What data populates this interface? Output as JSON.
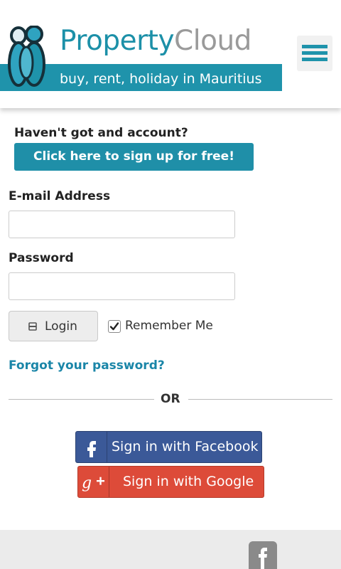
{
  "header": {
    "brand_primary": "Property",
    "brand_secondary": "Cloud",
    "tagline": "buy, rent, holiday in Mauritius",
    "menu_icon": "hamburger-icon",
    "colors": {
      "brand_teal": "#1f93ab",
      "brand_gray": "#9a9a9a"
    }
  },
  "signup": {
    "question": "Haven't got and account?",
    "button_label": "Click here to sign up for free!"
  },
  "form": {
    "email_label": "E-mail Address",
    "email_value": "",
    "password_label": "Password",
    "password_value": "",
    "login_label": "Login",
    "login_icon": "lock-icon",
    "remember_label": "Remember Me",
    "remember_checked": true,
    "forgot_label": "Forgot your password?"
  },
  "divider": {
    "label": "OR"
  },
  "social": {
    "facebook_label": "Sign in with Facebook",
    "facebook_icon": "facebook-icon",
    "google_label": "Sign in with Google",
    "google_icon": "google-plus-icon",
    "colors": {
      "facebook": "#3b5998",
      "google": "#dd4b39"
    }
  },
  "footer": {
    "social_icon": "facebook-icon"
  }
}
